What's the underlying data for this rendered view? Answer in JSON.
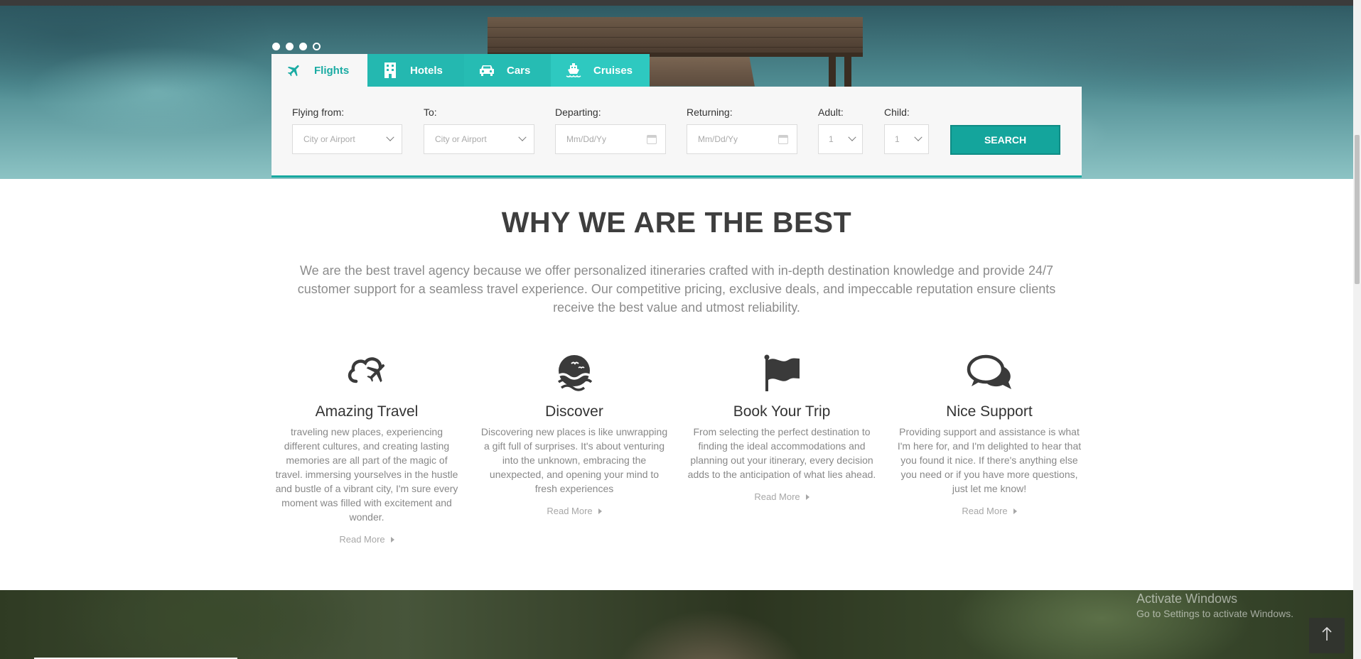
{
  "slider": {
    "dots": 4,
    "active_index": 3
  },
  "tabs": [
    {
      "label": "Flights",
      "icon": "plane-icon",
      "active": true
    },
    {
      "label": "Hotels",
      "icon": "building-icon",
      "active": false
    },
    {
      "label": "Cars",
      "icon": "car-icon",
      "active": false
    },
    {
      "label": "Cruises",
      "icon": "ship-icon",
      "active": false
    }
  ],
  "search_form": {
    "flying_from": {
      "label": "Flying from:",
      "placeholder": "City or Airport"
    },
    "to": {
      "label": "To:",
      "placeholder": "City or Airport"
    },
    "departing": {
      "label": "Departing:",
      "placeholder": "Mm/Dd/Yy"
    },
    "returning": {
      "label": "Returning:",
      "placeholder": "Mm/Dd/Yy"
    },
    "adult": {
      "label": "Adult:",
      "value": "1"
    },
    "child": {
      "label": "Child:",
      "value": "1"
    },
    "search_label": "SEARCH"
  },
  "why": {
    "title": "WHY WE ARE THE BEST",
    "description": "We are the best travel agency because we offer personalized itineraries crafted with in-depth destination knowledge and provide 24/7 customer support for a seamless travel experience. Our competitive pricing, exclusive deals, and impeccable reputation ensure clients receive the best value and utmost reliability."
  },
  "features": [
    {
      "icon": "cloud-plane-icon",
      "title": "Amazing Travel",
      "text": "traveling new places, experiencing different cultures, and creating lasting memories are all part of the magic of travel. immersing yourselves in the hustle and bustle of a vibrant city, I'm sure every moment was filled with excitement and wonder.",
      "more": "Read More"
    },
    {
      "icon": "sunset-waves-icon",
      "title": "Discover",
      "text": "Discovering new places is like unwrapping a gift full of surprises. It's about venturing into the unknown, embracing the unexpected, and opening your mind to fresh experiences",
      "more": "Read More"
    },
    {
      "icon": "flag-icon",
      "title": "Book Your Trip",
      "text": "From selecting the perfect destination to finding the ideal accommodations and planning out your itinerary, every decision adds to the anticipation of what lies ahead.",
      "more": "Read More"
    },
    {
      "icon": "chat-bubbles-icon",
      "title": "Nice Support",
      "text": "Providing support and assistance is what I'm here for, and I'm delighted to hear that you found it nice. If there's anything else you need or if you have more questions, just let me know!",
      "more": "Read More"
    }
  ],
  "watermark": {
    "title": "Activate Windows",
    "subtitle": "Go to Settings to activate Windows."
  },
  "colors": {
    "accent": "#14a59c",
    "tab_active_text": "#1aaba3",
    "heading": "#3e3e3e",
    "muted_text": "#8c8c8c"
  }
}
